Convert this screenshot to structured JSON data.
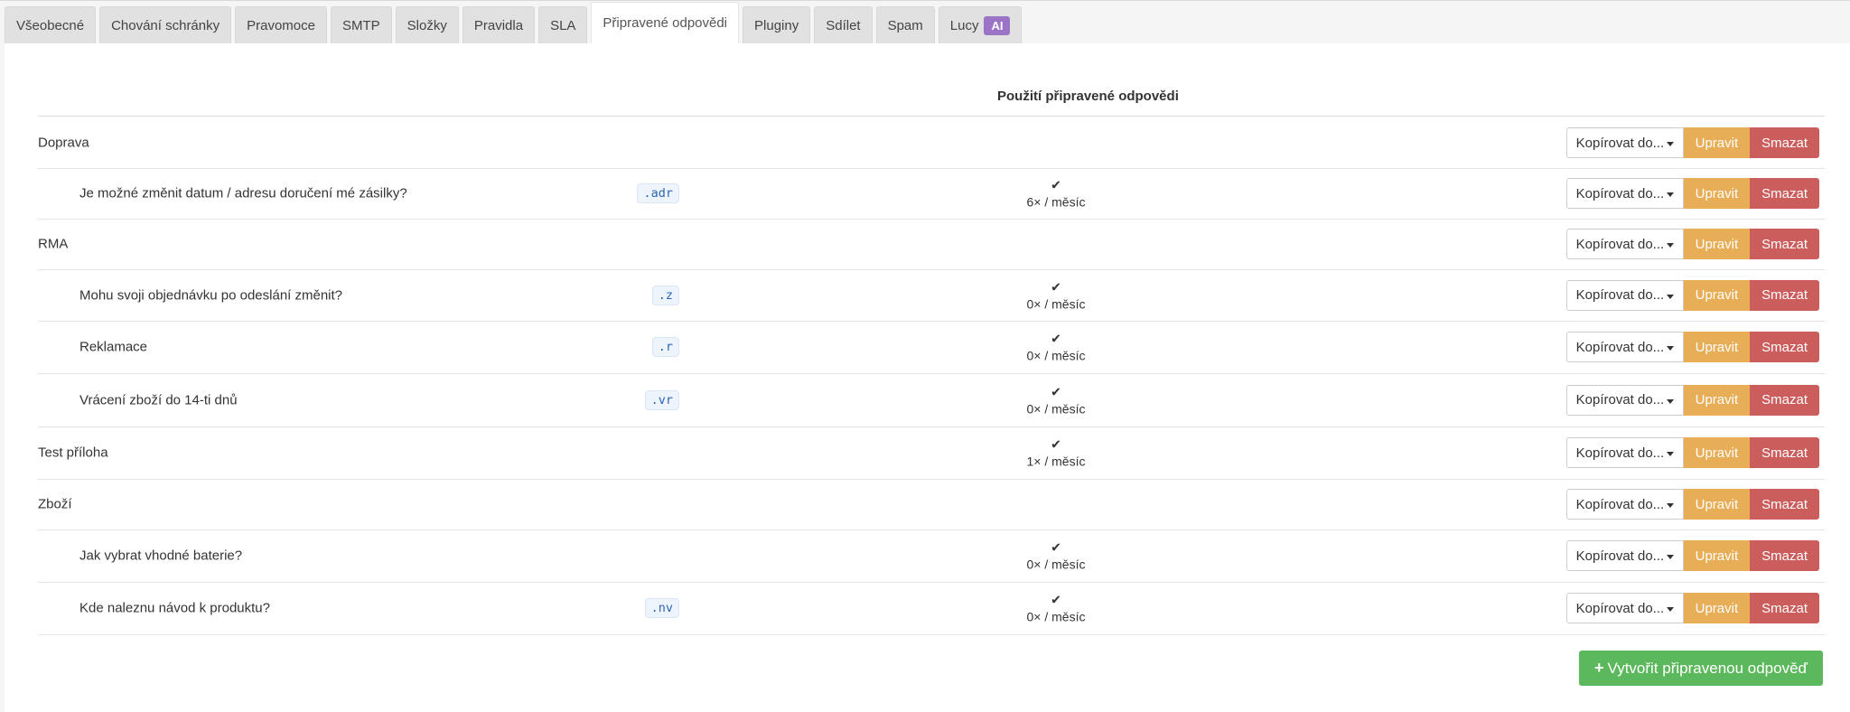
{
  "tabs": [
    {
      "label": "Všeobecné"
    },
    {
      "label": "Chování schránky"
    },
    {
      "label": "Pravomoce"
    },
    {
      "label": "SMTP"
    },
    {
      "label": "Složky"
    },
    {
      "label": "Pravidla"
    },
    {
      "label": "SLA"
    },
    {
      "label": "Připravené odpovědi",
      "active": true
    },
    {
      "label": "Pluginy"
    },
    {
      "label": "Sdílet"
    },
    {
      "label": "Spam"
    },
    {
      "label": "Lucy",
      "badge": "AI"
    }
  ],
  "table": {
    "usage_header": "Použití připravené odpovědi"
  },
  "rows": [
    {
      "type": "group",
      "name": "Doprava",
      "shortcut": "",
      "usage": ""
    },
    {
      "type": "item",
      "name": "Je možné změnit datum / adresu doručení mé zásilky?",
      "shortcut": ".adr",
      "usage": "6× / měsíc"
    },
    {
      "type": "group",
      "name": "RMA",
      "shortcut": "",
      "usage": ""
    },
    {
      "type": "item",
      "name": "Mohu svoji objednávku po odeslání změnit?",
      "shortcut": ".z",
      "usage": "0× / měsíc"
    },
    {
      "type": "item",
      "name": "Reklamace",
      "shortcut": ".r",
      "usage": "0× / měsíc"
    },
    {
      "type": "item",
      "name": "Vrácení zboží do 14-ti dnů",
      "shortcut": ".vr",
      "usage": "0× / měsíc"
    },
    {
      "type": "group",
      "name": "Test příloha",
      "shortcut": "",
      "usage": "1× / měsíc"
    },
    {
      "type": "group",
      "name": "Zboží",
      "shortcut": "",
      "usage": ""
    },
    {
      "type": "item",
      "name": "Jak vybrat vhodné baterie?",
      "shortcut": "",
      "usage": "0× / měsíc"
    },
    {
      "type": "item",
      "name": "Kde naleznu návod k produktu?",
      "shortcut": ".nv",
      "usage": "0× / měsíc"
    }
  ],
  "actions": {
    "copy_label": "Kopírovat do...",
    "edit_label": "Upravit",
    "delete_label": "Smazat"
  },
  "create_button": "Vytvořit připravenou odpověď",
  "colors": {
    "edit": "#e7ad57",
    "delete": "#cb5d5d",
    "create": "#5cb85c",
    "ai_badge": "#9b74c8"
  }
}
